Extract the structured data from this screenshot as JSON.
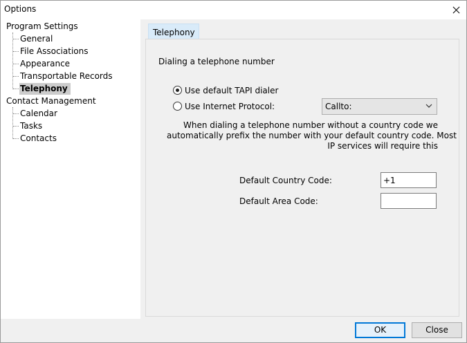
{
  "window": {
    "title": "Options"
  },
  "tree": {
    "program_settings": "Program Settings",
    "program_children": [
      "General",
      "File Associations",
      "Appearance",
      "Transportable Records",
      "Telephony"
    ],
    "contact_management": "Contact Management",
    "contact_children": [
      "Calendar",
      "Tasks",
      "Contacts"
    ]
  },
  "tab": {
    "label": "Telephony"
  },
  "telephony": {
    "section_title": "Dialing a telephone number",
    "radio_tapi": "Use default TAPI dialer",
    "radio_ip": "Use Internet Protocol:",
    "protocol_selected": "Callto:",
    "help_lines": [
      "When dialing a telephone number without a country code we",
      "automatically prefix the number with your default country code.  Most",
      "IP services will require this"
    ],
    "country_code_label": "Default Country Code:",
    "country_code_value": "+1",
    "area_code_label": "Default Area Code:",
    "area_code_value": ""
  },
  "buttons": {
    "ok": "OK",
    "close": "Close"
  }
}
